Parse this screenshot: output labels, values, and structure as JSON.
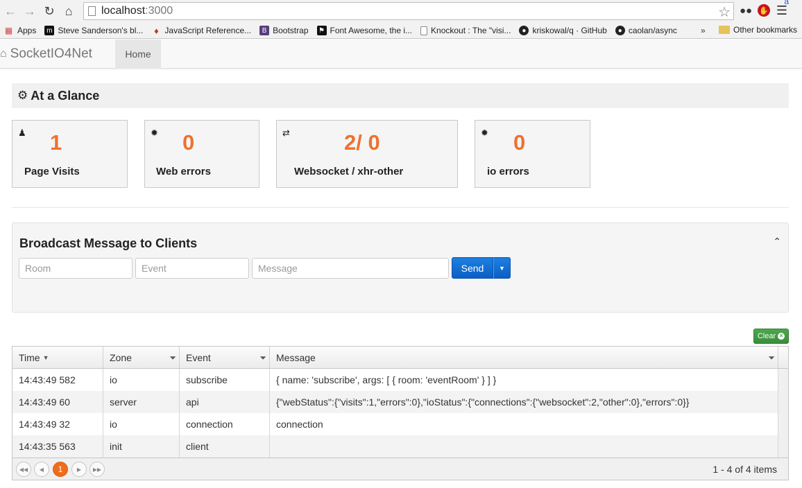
{
  "browser": {
    "url_host": "localhost",
    "url_port": ":3000",
    "bookmarks": [
      {
        "label": "Apps",
        "icon": "apps-grid-icon"
      },
      {
        "label": "Steve Sanderson's bl...",
        "icon": "m-logo-icon"
      },
      {
        "label": "JavaScript Reference...",
        "icon": "js-dino-icon"
      },
      {
        "label": "Bootstrap",
        "icon": "bootstrap-b-icon"
      },
      {
        "label": "Font Awesome, the i...",
        "icon": "flag-icon"
      },
      {
        "label": "Knockout : The \"visi...",
        "icon": "page-icon"
      },
      {
        "label": "kriskowal/q · GitHub",
        "icon": "github-icon"
      },
      {
        "label": "caolan/async",
        "icon": "github-icon"
      }
    ],
    "bookmarks_more": "»",
    "other_bookmarks": "Other bookmarks"
  },
  "navbar": {
    "brand": "SocketIO4Net",
    "home_tab": "Home"
  },
  "glance": {
    "title": "At a Glance",
    "cards": [
      {
        "value": "1",
        "label": "Page Visits",
        "icon": "user-icon"
      },
      {
        "value": "0",
        "label": "Web errors",
        "icon": "bug-icon"
      },
      {
        "value": "2/ 0",
        "label": "Websocket / xhr-other",
        "icon": "exchange-icon"
      },
      {
        "value": "0",
        "label": "io errors",
        "icon": "bug-icon"
      }
    ],
    "accent_color": "#ee7130"
  },
  "broadcast": {
    "title": "Broadcast Message to Clients",
    "room_placeholder": "Room",
    "event_placeholder": "Event",
    "message_placeholder": "Message",
    "send_label": "Send"
  },
  "grid": {
    "clear_label": "Clear",
    "columns": [
      "Time",
      "Zone",
      "Event",
      "Message"
    ],
    "rows": [
      {
        "time": "14:43:49 582",
        "zone": "io",
        "event": "subscribe",
        "message": "{ name: 'subscribe', args: [ { room: 'eventRoom' } ] }"
      },
      {
        "time": "14:43:49 60",
        "zone": "server",
        "event": "api",
        "message": "{\"webStatus\":{\"visits\":1,\"errors\":0},\"ioStatus\":{\"connections\":{\"websocket\":2,\"other\":0},\"errors\":0}}"
      },
      {
        "time": "14:43:49 32",
        "zone": "io",
        "event": "connection",
        "message": "connection"
      },
      {
        "time": "14:43:35 563",
        "zone": "init",
        "event": "client",
        "message": ""
      }
    ],
    "pager": {
      "current_page": "1",
      "info": "1 - 4 of 4 items"
    }
  }
}
